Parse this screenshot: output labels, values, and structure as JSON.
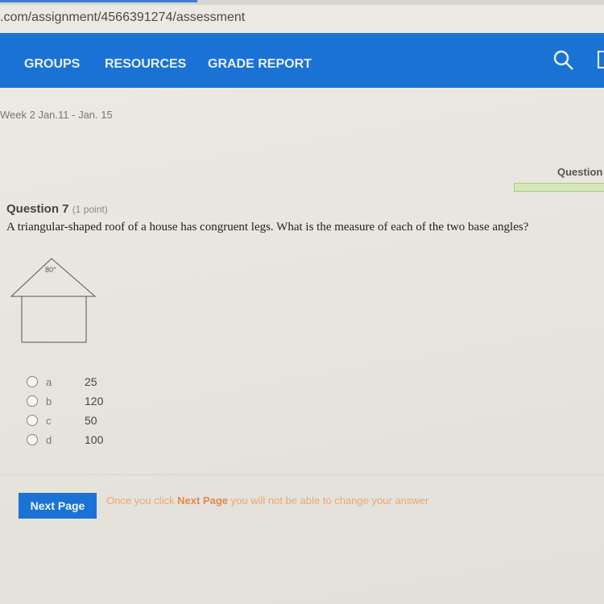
{
  "browser": {
    "url": ".com/assignment/4566391274/assessment"
  },
  "nav": {
    "items": [
      "GROUPS",
      "RESOURCES",
      "GRADE REPORT"
    ],
    "color": "#1a73d4"
  },
  "breadcrumb": "Week 2 Jan.11 - Jan. 15",
  "progress": {
    "label": "Question"
  },
  "question": {
    "title": "Question 7",
    "points": "(1 point)",
    "text": "A triangular-shaped roof of a house has congruent legs. What is the measure of each of the two base angles?",
    "figure_angle": "80°",
    "choices": [
      {
        "letter": "a",
        "value": "25"
      },
      {
        "letter": "b",
        "value": "120"
      },
      {
        "letter": "c",
        "value": "50"
      },
      {
        "letter": "d",
        "value": "100"
      }
    ]
  },
  "footer": {
    "next_label": "Next Page",
    "note_before": "Once you click ",
    "note_bold": "Next Page",
    "note_after": " you will not be able to change your answer"
  }
}
